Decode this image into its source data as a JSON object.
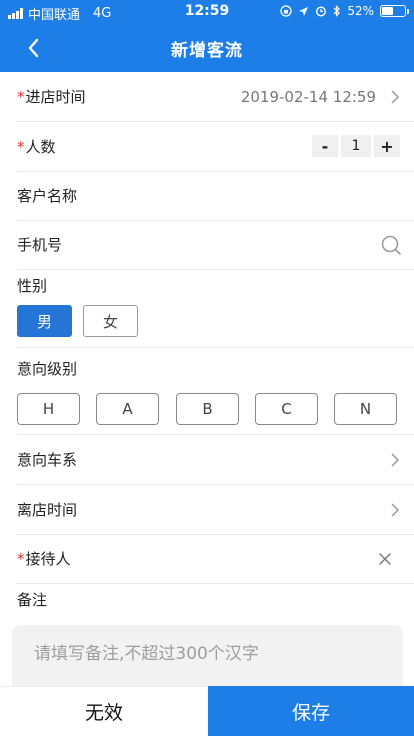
{
  "status_bar": {
    "carrier": "中国联通",
    "network": "4G",
    "time": "12:59",
    "battery": "52%",
    "battery_level": 0.52
  },
  "nav": {
    "title": "新增客流"
  },
  "form": {
    "required_mark": "*",
    "entry_time": {
      "label": "进店时间",
      "value": "2019-02-14 12:59"
    },
    "people_count": {
      "label": "人数",
      "minus": "-",
      "value": "1",
      "plus": "+"
    },
    "customer_name": {
      "label": "客户名称"
    },
    "phone": {
      "label": "手机号"
    },
    "gender": {
      "label": "性别",
      "options": [
        "男",
        "女"
      ],
      "selected": "男"
    },
    "intent_level": {
      "label": "意向级别",
      "options": [
        "H",
        "A",
        "B",
        "C",
        "N"
      ]
    },
    "intent_series": {
      "label": "意向车系"
    },
    "leave_time": {
      "label": "离店时间"
    },
    "receptionist": {
      "label": "接待人"
    },
    "remark": {
      "label": "备注",
      "placeholder": "请填写备注,不超过300个汉字"
    }
  },
  "actions": {
    "invalid": "无效",
    "save": "保存"
  },
  "colors": {
    "accent": "#1e7ee8",
    "required": "#e0302a",
    "selected": "#2475d6"
  }
}
